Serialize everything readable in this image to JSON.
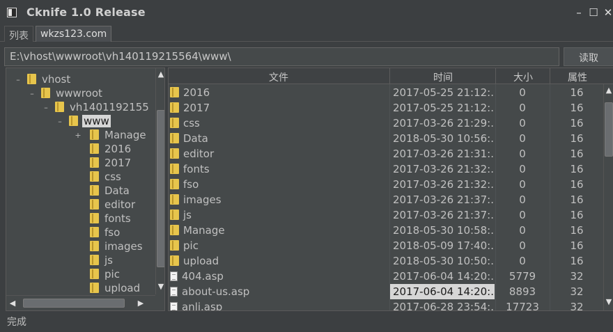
{
  "window": {
    "title": "Cknife 1.0 Release",
    "minimize_glyph": "–",
    "maximize_glyph": "☐",
    "close_glyph": "✕"
  },
  "tabs": [
    {
      "label": "列表",
      "active": false
    },
    {
      "label": "wkzs123.com",
      "active": true
    }
  ],
  "path_bar": {
    "value": "E:\\vhost\\wwwroot\\vh140119215564\\www\\",
    "read_button": "读取"
  },
  "tree": {
    "rows": [
      {
        "label": "vhost",
        "expander": "–"
      },
      {
        "label": "wwwroot",
        "expander": "–"
      },
      {
        "label": "vh1401192155",
        "expander": "–"
      },
      {
        "label": "www",
        "expander": "–",
        "selected": true
      },
      {
        "label": "Manage",
        "expander": "+"
      },
      {
        "label": "2016"
      },
      {
        "label": "2017"
      },
      {
        "label": "css"
      },
      {
        "label": "Data"
      },
      {
        "label": "editor"
      },
      {
        "label": "fonts"
      },
      {
        "label": "fso"
      },
      {
        "label": "images"
      },
      {
        "label": "js"
      },
      {
        "label": "pic"
      },
      {
        "label": "upload"
      }
    ]
  },
  "table": {
    "headers": {
      "name": "文件",
      "time": "时间",
      "size": "大小",
      "attr": "属性"
    },
    "rows": [
      {
        "type": "folder",
        "name": "2016",
        "time": "2017-05-25 21:12:...",
        "size": "0",
        "attr": "16"
      },
      {
        "type": "folder",
        "name": "2017",
        "time": "2017-05-25 21:12:...",
        "size": "0",
        "attr": "16"
      },
      {
        "type": "folder",
        "name": "css",
        "time": "2017-03-26 21:29:...",
        "size": "0",
        "attr": "16"
      },
      {
        "type": "folder",
        "name": "Data",
        "time": "2018-05-30 10:56:...",
        "size": "0",
        "attr": "16"
      },
      {
        "type": "folder",
        "name": "editor",
        "time": "2017-03-26 21:31:...",
        "size": "0",
        "attr": "16"
      },
      {
        "type": "folder",
        "name": "fonts",
        "time": "2017-03-26 21:32:...",
        "size": "0",
        "attr": "16"
      },
      {
        "type": "folder",
        "name": "fso",
        "time": "2017-03-26 21:32:...",
        "size": "0",
        "attr": "16"
      },
      {
        "type": "folder",
        "name": "images",
        "time": "2017-03-26 21:37:...",
        "size": "0",
        "attr": "16"
      },
      {
        "type": "folder",
        "name": "js",
        "time": "2017-03-26 21:37:...",
        "size": "0",
        "attr": "16"
      },
      {
        "type": "folder",
        "name": "Manage",
        "time": "2018-05-30 10:58:...",
        "size": "0",
        "attr": "16"
      },
      {
        "type": "folder",
        "name": "pic",
        "time": "2018-05-09 17:40:...",
        "size": "0",
        "attr": "16"
      },
      {
        "type": "folder",
        "name": "upload",
        "time": "2018-05-30 10:50:...",
        "size": "0",
        "attr": "16"
      },
      {
        "type": "file",
        "name": "404.asp",
        "time": "2017-06-04 14:20:...",
        "size": "5779",
        "attr": "32"
      },
      {
        "type": "file",
        "name": "about-us.asp",
        "time": "2017-06-04 14:20:...",
        "size": "8893",
        "attr": "32",
        "highlight_time": true
      },
      {
        "type": "file",
        "name": "anli.asp",
        "time": "2017-06-28 23:54:...",
        "size": "17723",
        "attr": "32"
      }
    ]
  },
  "status": "完成",
  "scroll_glyphs": {
    "up": "▲",
    "down": "▼",
    "left": "◀",
    "right": "▶"
  }
}
